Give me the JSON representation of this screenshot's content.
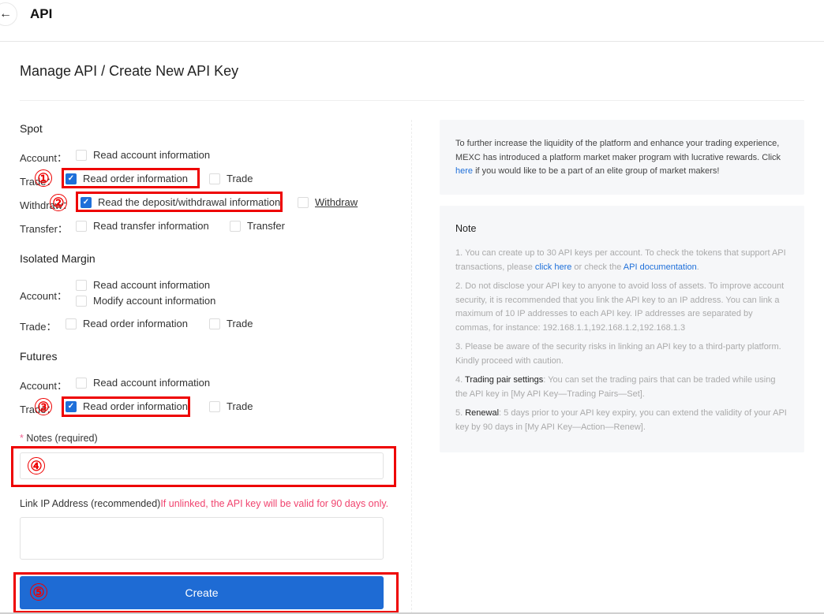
{
  "header": {
    "title": "API",
    "back_icon": "arrow-left-icon"
  },
  "breadcrumb": "Manage API / Create New API Key",
  "sections": {
    "spot": {
      "title": "Spot",
      "account_label": "Account：",
      "account_read": {
        "label": "Read account information",
        "checked": false
      },
      "trade_label": "Trade：",
      "trade_read": {
        "label": "Read order information",
        "checked": true
      },
      "trade_trade": {
        "label": "Trade",
        "checked": false
      },
      "withdraw_label": "Withdraw：",
      "withdraw_read": {
        "label": "Read the deposit/withdrawal information",
        "checked": true
      },
      "withdraw_withdraw": {
        "label": "Withdraw",
        "checked": false
      },
      "transfer_label": "Transfer：",
      "transfer_read": {
        "label": "Read transfer information",
        "checked": false
      },
      "transfer_transfer": {
        "label": "Transfer",
        "checked": false
      }
    },
    "isolated_margin": {
      "title": "Isolated Margin",
      "account_label": "Account：",
      "account_read": {
        "label": "Read account information",
        "checked": false
      },
      "account_modify": {
        "label": "Modify account information",
        "checked": false
      },
      "trade_label": "Trade：",
      "trade_read": {
        "label": "Read order information",
        "checked": false
      },
      "trade_trade": {
        "label": "Trade",
        "checked": false
      }
    },
    "futures": {
      "title": "Futures",
      "account_label": "Account：",
      "account_read": {
        "label": "Read account information",
        "checked": false
      },
      "trade_label": "Trade：",
      "trade_read": {
        "label": "Read order information",
        "checked": true
      },
      "trade_trade": {
        "label": "Trade",
        "checked": false
      }
    }
  },
  "notes_field": {
    "star": "*",
    "label": "Notes (required)",
    "value": ""
  },
  "ip_field": {
    "label": "Link IP Address (recommended)",
    "warning": "If unlinked, the API key will be valid for 90 days only.",
    "value": ""
  },
  "create_button": "Create",
  "annotations": [
    "①",
    "②",
    "③",
    "④",
    "⑤"
  ],
  "promo": {
    "text_before": "To further increase the liquidity of the platform and enhance your trading experience, MEXC has introduced a platform market maker program with lucrative rewards. Click ",
    "link": "here",
    "text_after": " if you would like to be a part of an elite group of market makers!"
  },
  "note": {
    "title": "Note",
    "item1_a": "1. You can create up to 30 API keys per account. To check the tokens that support API transactions, please ",
    "item1_link1": "click here",
    "item1_b": " or check the ",
    "item1_link2": "API documentation",
    "item1_c": ".",
    "item2": "2. Do not disclose your API key to anyone to avoid loss of assets. To improve account security, it is recommended that you link the API key to an IP address. You can link a maximum of 10 IP addresses to each API key. IP addresses are separated by commas, for instance: 192.168.1.1,192.168.1.2,192.168.1.3",
    "item3": "3. Please be aware of the security risks in linking an API key to a third-party platform. Kindly proceed with caution.",
    "item4_num": "4. ",
    "item4_bold": "Trading pair settings",
    "item4_text": ": You can set the trading pairs that can be traded while using the API key in [My API Key—Trading Pairs—Set].",
    "item5_num": "5. ",
    "item5_bold": "Renewal",
    "item5_text": ": 5 days prior to your API key expiry, you can extend the validity of your API key by 90 days in [My API Key—Action—Renew]."
  },
  "colors": {
    "accent": "#1e6fd9",
    "button": "#1e6bd4",
    "annotation": "#ee0000",
    "warning": "#f0436e"
  }
}
